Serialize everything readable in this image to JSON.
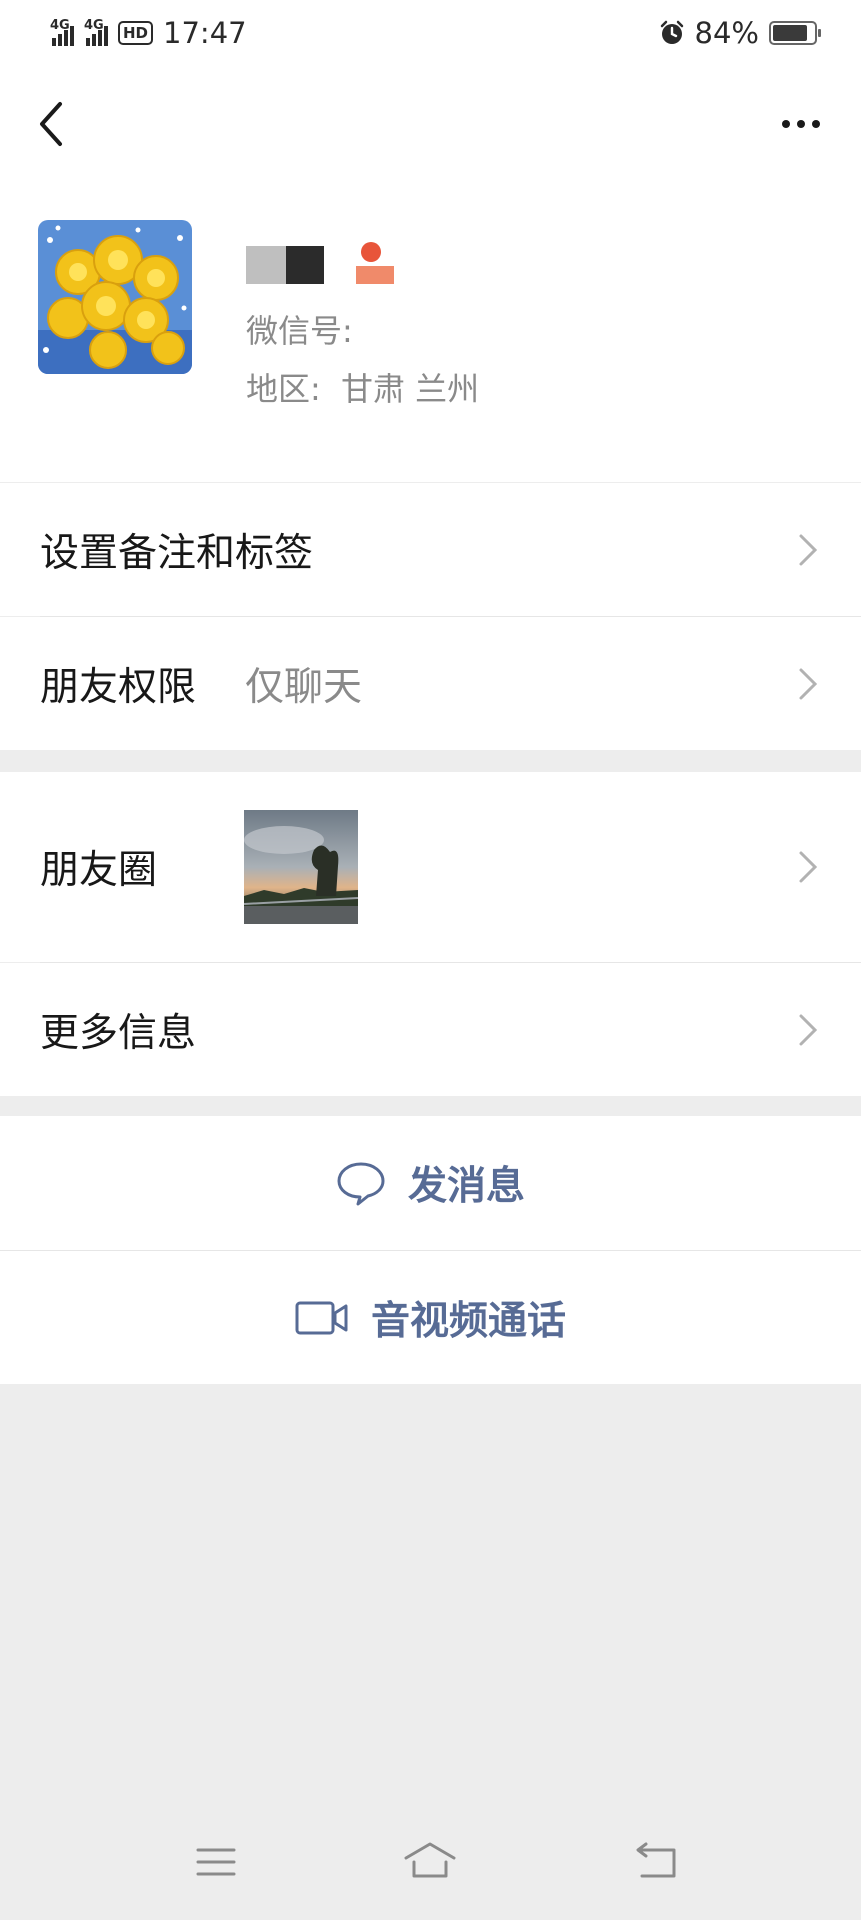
{
  "status_bar": {
    "network_1": "4G",
    "network_2": "4G",
    "hd_badge": "HD",
    "time": "17:47",
    "battery_percent": "84%",
    "battery_level": 0.84
  },
  "profile": {
    "wechat_id_label": "微信号:",
    "wechat_id_value": "",
    "region_label": "地区:",
    "region_value": "甘肃  兰州"
  },
  "menu": {
    "remarks_tags": "设置备注和标签",
    "permissions_label": "朋友权限",
    "permissions_value": "仅聊天",
    "moments_label": "朋友圈",
    "more_info": "更多信息"
  },
  "actions": {
    "send_message": "发消息",
    "video_call": "音视频通话"
  },
  "colors": {
    "accent": "#576b95",
    "background": "#ededed"
  }
}
